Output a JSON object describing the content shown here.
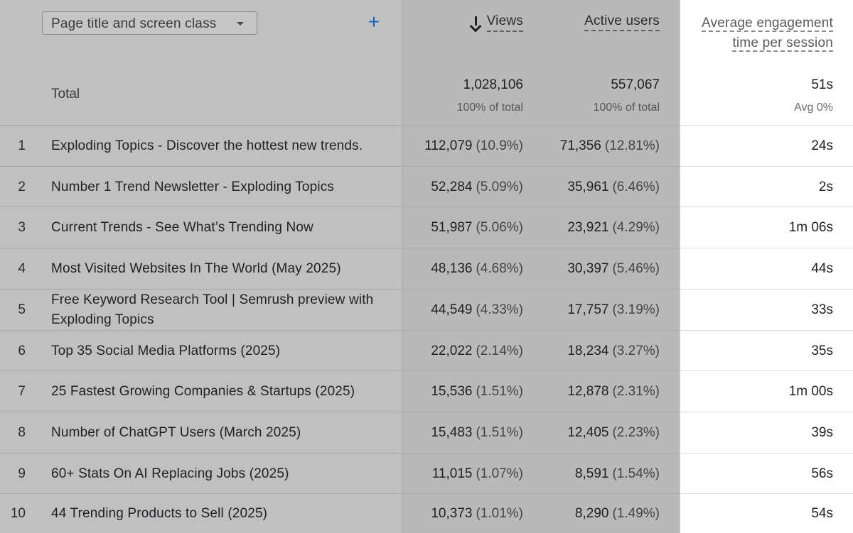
{
  "header": {
    "dimension_select": "Page title and screen class",
    "add_button": "+",
    "col_views": "Views",
    "col_active_users": "Active users",
    "col_engagement_line1": "Average engagement",
    "col_engagement_line2": "time per session"
  },
  "totals": {
    "label": "Total",
    "views": "1,028,106",
    "views_sub": "100% of total",
    "active_users": "557,067",
    "active_users_sub": "100% of total",
    "engagement": "51s",
    "engagement_sub": "Avg 0%"
  },
  "rows": [
    {
      "rank": "1",
      "title": "Exploding Topics - Discover the hottest new trends.",
      "views": "112,079",
      "views_pct": "(10.9%)",
      "users": "71,356",
      "users_pct": "(12.81%)",
      "engagement": "24s"
    },
    {
      "rank": "2",
      "title": "Number 1 Trend Newsletter - Exploding Topics",
      "views": "52,284",
      "views_pct": "(5.09%)",
      "users": "35,961",
      "users_pct": "(6.46%)",
      "engagement": "2s"
    },
    {
      "rank": "3",
      "title": "Current Trends - See What’s Trending Now",
      "views": "51,987",
      "views_pct": "(5.06%)",
      "users": "23,921",
      "users_pct": "(4.29%)",
      "engagement": "1m 06s"
    },
    {
      "rank": "4",
      "title": "Most Visited Websites In The World (May 2025)",
      "views": "48,136",
      "views_pct": "(4.68%)",
      "users": "30,397",
      "users_pct": "(5.46%)",
      "engagement": "44s"
    },
    {
      "rank": "5",
      "title": "Free Keyword Research Tool | Semrush preview with Exploding Topics",
      "views": "44,549",
      "views_pct": "(4.33%)",
      "users": "17,757",
      "users_pct": "(3.19%)",
      "engagement": "33s"
    },
    {
      "rank": "6",
      "title": "Top 35 Social Media Platforms (2025)",
      "views": "22,022",
      "views_pct": "(2.14%)",
      "users": "18,234",
      "users_pct": "(3.27%)",
      "engagement": "35s"
    },
    {
      "rank": "7",
      "title": "25 Fastest Growing Companies & Startups (2025)",
      "views": "15,536",
      "views_pct": "(1.51%)",
      "users": "12,878",
      "users_pct": "(2.31%)",
      "engagement": "1m 00s"
    },
    {
      "rank": "8",
      "title": "Number of ChatGPT Users (March 2025)",
      "views": "15,483",
      "views_pct": "(1.51%)",
      "users": "12,405",
      "users_pct": "(2.23%)",
      "engagement": "39s"
    },
    {
      "rank": "9",
      "title": "60+ Stats On AI Replacing Jobs (2025)",
      "views": "11,015",
      "views_pct": "(1.07%)",
      "users": "8,591",
      "users_pct": "(1.54%)",
      "engagement": "56s"
    },
    {
      "rank": "10",
      "title": "44 Trending Products to Sell (2025)",
      "views": "10,373",
      "views_pct": "(1.01%)",
      "users": "8,290",
      "users_pct": "(1.49%)",
      "engagement": "54s"
    }
  ]
}
